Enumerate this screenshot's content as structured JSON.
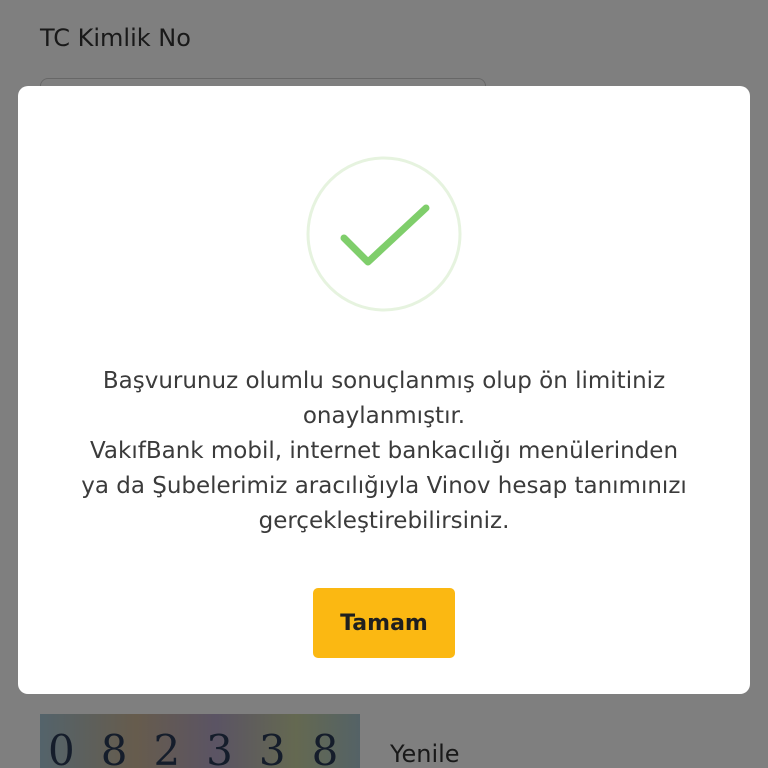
{
  "form": {
    "field_label": "TC Kimlik No",
    "captcha_text": "082338",
    "refresh_label": "Yenile"
  },
  "dialog": {
    "icon": "checkmark-icon",
    "message_line1": "Başvurunuz olumlu sonuçlanmış olup ön limitiniz",
    "message_line2": "onaylanmıştır.",
    "message_line3": "VakıfBank mobil, internet bankacılığı menülerinden",
    "message_line4": "ya da Şubelerimiz aracılığıyla Vinov hesap tanımınızı",
    "message_line5": "gerçekleştirebilirsiniz.",
    "ok_label": "Tamam"
  },
  "colors": {
    "accent": "#fbb812",
    "success_green": "#7fce6b",
    "success_ring": "#e6f3df",
    "overlay": "#808080"
  }
}
